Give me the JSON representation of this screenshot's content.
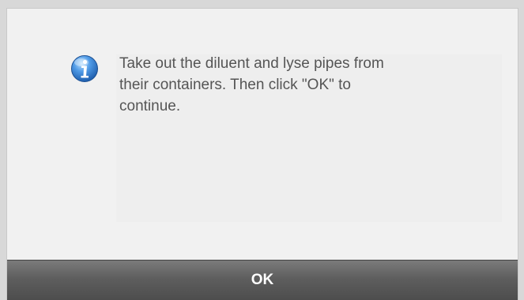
{
  "dialog": {
    "icon": "info-icon",
    "message": "Take out the diluent and lyse pipes from\ntheir containers. Then click \"OK\" to\ncontinue.",
    "ok_label": "OK"
  },
  "colors": {
    "icon_blue": "#3b7fd0",
    "button_dark": "#5e5e5e"
  }
}
